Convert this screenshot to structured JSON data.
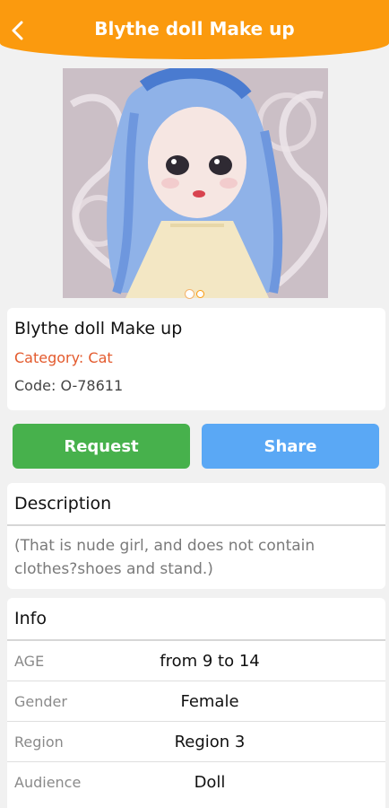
{
  "header": {
    "title": "Blythe doll Make up",
    "back_icon": "chevron-left-icon",
    "color": "#fb9a0e"
  },
  "gallery": {
    "image_alt": "doll-photo",
    "pages": 2,
    "current_page": 1
  },
  "product": {
    "name": "Blythe doll Make up",
    "category": "Category: Cat",
    "code": "Code: O-78611"
  },
  "actions": {
    "request_label": "Request",
    "share_label": "Share",
    "request_color": "#47b14c",
    "share_color": "#5aa8f5"
  },
  "description": {
    "heading": "Description",
    "text": "(That is nude girl, and does not contain clothes?shoes and stand.)"
  },
  "info": {
    "heading": "Info",
    "rows": [
      {
        "key": "AGE",
        "value": "from 9 to 14"
      },
      {
        "key": "Gender",
        "value": "Female"
      },
      {
        "key": "Region",
        "value": "Region 3"
      },
      {
        "key": "Audience",
        "value": "Doll"
      }
    ]
  }
}
